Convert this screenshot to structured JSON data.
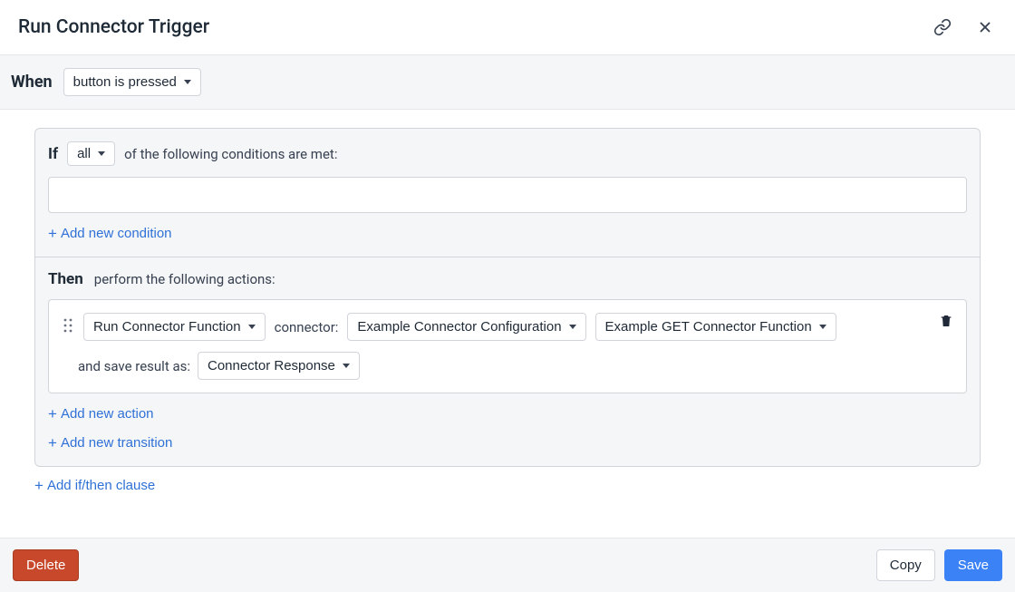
{
  "header": {
    "title": "Run Connector Trigger"
  },
  "when": {
    "label": "When",
    "trigger": "button is pressed"
  },
  "clause": {
    "if": {
      "label": "If",
      "mode": "all",
      "suffix": "of the following conditions are met:",
      "add": "Add new condition"
    },
    "then": {
      "label": "Then",
      "suffix": "perform the following actions:",
      "action": {
        "type": "Run Connector Function",
        "connector_label": "connector:",
        "connector": "Example Connector Configuration",
        "function": "Example GET Connector Function",
        "save_label": "and save result as:",
        "save_as": "Connector Response"
      },
      "add_action": "Add new action",
      "add_transition": "Add new transition"
    }
  },
  "add_clause": "Add if/then clause",
  "footer": {
    "delete": "Delete",
    "copy": "Copy",
    "save": "Save"
  }
}
